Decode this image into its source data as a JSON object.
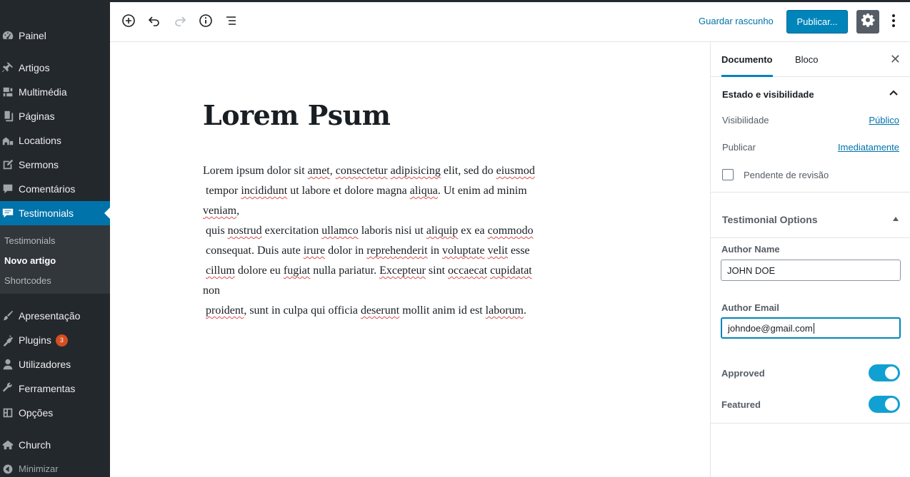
{
  "admin_menu": {
    "items": [
      {
        "label": "Painel",
        "icon": "dashboard-icon"
      },
      {
        "label": "Artigos",
        "icon": "pin-icon"
      },
      {
        "label": "Multimédia",
        "icon": "media-icon"
      },
      {
        "label": "Páginas",
        "icon": "pages-icon"
      },
      {
        "label": "Locations",
        "icon": "location-icon"
      },
      {
        "label": "Sermons",
        "icon": "edit-icon"
      },
      {
        "label": "Comentários",
        "icon": "comment-icon"
      },
      {
        "label": "Testimonials",
        "icon": "testimonial-icon"
      },
      {
        "label": "Apresentação",
        "icon": "brush-icon"
      },
      {
        "label": "Plugins",
        "icon": "plugin-icon"
      },
      {
        "label": "Utilizadores",
        "icon": "user-icon"
      },
      {
        "label": "Ferramentas",
        "icon": "wrench-icon"
      },
      {
        "label": "Opções",
        "icon": "settings-icon"
      },
      {
        "label": "Church",
        "icon": "church-icon"
      }
    ],
    "plugins_badge": "3",
    "submenu": [
      "Testimonials",
      "Novo artigo",
      "Shortcodes"
    ],
    "collapse_label": "Minimizar"
  },
  "toolbar": {
    "save_draft": "Guardar rascunho",
    "publish": "Publicar..."
  },
  "post": {
    "title": "Lorem Psum",
    "lines": [
      [
        "Lorem ipsum dolor sit ",
        {
          "w": "amet"
        },
        ", ",
        {
          "w": "consectetur"
        },
        " ",
        {
          "w": "adipisicing"
        },
        " elit, sed do ",
        {
          "w": "eiusmod"
        }
      ],
      [
        " tempor ",
        {
          "w": "incididunt"
        },
        " ut labore et dolore magna ",
        {
          "w": "aliqua"
        },
        ". Ut enim ad minim"
      ],
      [
        {
          "w": "veniam"
        },
        ","
      ],
      [
        " quis ",
        {
          "w": "nostrud"
        },
        " exercitation ",
        {
          "w": "ullamco"
        },
        " laboris nisi ut ",
        {
          "w": "aliquip"
        },
        " ex ea ",
        {
          "w": "commodo"
        }
      ],
      [
        " consequat. Duis aute ",
        {
          "w": "irure"
        },
        " dolor in ",
        {
          "w": "reprehenderit"
        },
        " in ",
        {
          "w": "voluptate"
        },
        " ",
        {
          "w": "velit"
        },
        " esse"
      ],
      [
        " ",
        {
          "w": "cillum"
        },
        " dolore eu ",
        {
          "w": "fugiat"
        },
        " nulla pariatur. ",
        {
          "w": "Excepteur"
        },
        " sint ",
        {
          "w": "occaecat"
        },
        " ",
        {
          "w": "cupidatat"
        }
      ],
      [
        "non"
      ],
      [
        " ",
        {
          "w": "proident"
        },
        ", sunt in culpa qui officia ",
        {
          "w": "deserunt"
        },
        " mollit anim id est ",
        {
          "w": "laborum"
        },
        "."
      ]
    ]
  },
  "sidebar": {
    "tabs": {
      "document": "Documento",
      "block": "Bloco"
    },
    "status_panel": {
      "title": "Estado e visibilidade",
      "visibility_label": "Visibilidade",
      "visibility_value": "Público",
      "publish_label": "Publicar",
      "publish_value": "Imediatamente",
      "pending_review": "Pendente de revisão"
    },
    "testimonial_options": {
      "title": "Testimonial Options",
      "author_name_label": "Author Name",
      "author_name_value": "JOHN DOE",
      "author_email_label": "Author Email",
      "author_email_value": "johndoe@gmail.com",
      "approved_label": "Approved",
      "approved": true,
      "featured_label": "Featured",
      "featured": true
    }
  },
  "colors": {
    "admin_bg": "#23282d",
    "admin_active": "#0073aa",
    "publish_button": "#0085ba",
    "toggle_on": "#11a0d2"
  }
}
